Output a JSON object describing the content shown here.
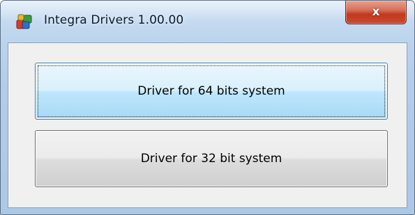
{
  "window": {
    "title": "Integra Drivers 1.00.00",
    "close_label": "x"
  },
  "buttons": {
    "driver_64_label": "Driver for 64 bits system",
    "driver_32_label": "Driver for 32 bit system"
  },
  "icons": {
    "app": "app-icon",
    "close": "close-icon"
  },
  "colors": {
    "close_red": "#c0391f",
    "focus_blue": "#3c7fb1"
  }
}
